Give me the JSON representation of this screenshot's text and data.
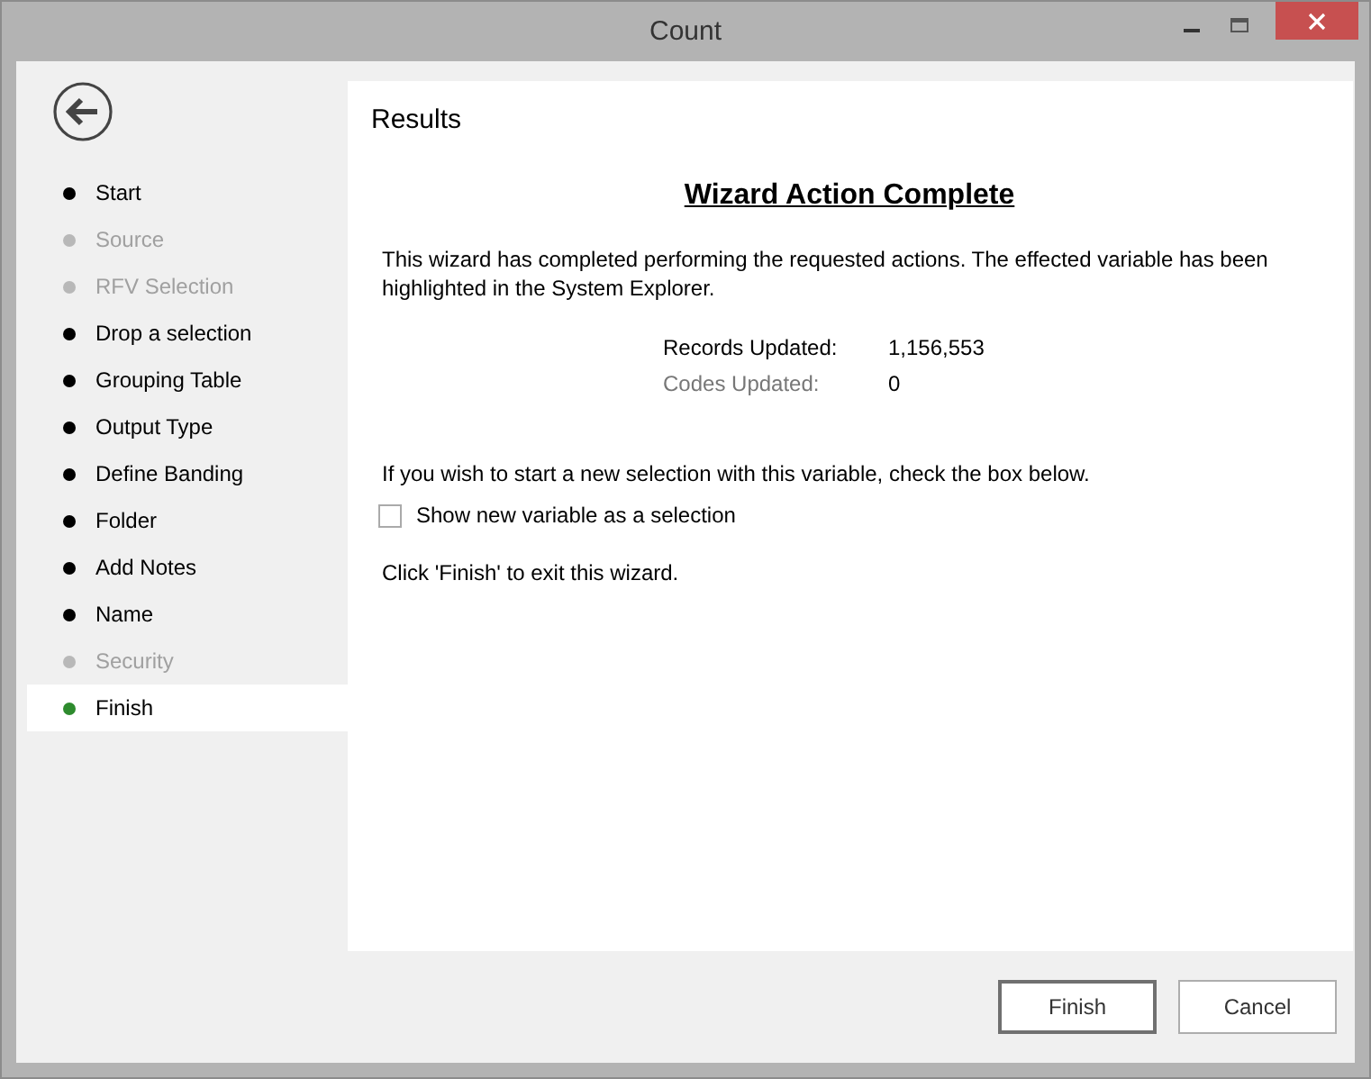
{
  "window": {
    "title": "Count"
  },
  "steps": [
    {
      "label": "Start",
      "disabled": false,
      "selected": false
    },
    {
      "label": "Source",
      "disabled": true,
      "selected": false
    },
    {
      "label": "RFV Selection",
      "disabled": true,
      "selected": false
    },
    {
      "label": "Drop a selection",
      "disabled": false,
      "selected": false
    },
    {
      "label": "Grouping Table",
      "disabled": false,
      "selected": false
    },
    {
      "label": "Output Type",
      "disabled": false,
      "selected": false
    },
    {
      "label": "Define Banding",
      "disabled": false,
      "selected": false
    },
    {
      "label": "Folder",
      "disabled": false,
      "selected": false
    },
    {
      "label": "Add Notes",
      "disabled": false,
      "selected": false
    },
    {
      "label": "Name",
      "disabled": false,
      "selected": false
    },
    {
      "label": "Security",
      "disabled": true,
      "selected": false
    },
    {
      "label": "Finish",
      "disabled": false,
      "selected": true
    }
  ],
  "page": {
    "title": "Results",
    "heading": "Wizard Action Complete",
    "message": "This wizard has completed performing the requested actions. The effected variable has been highlighted in the System Explorer.",
    "stats": [
      {
        "label": "Records Updated:",
        "value": "1,156,553",
        "disabled": false
      },
      {
        "label": "Codes Updated:",
        "value": "0",
        "disabled": true
      }
    ],
    "hint": "If you wish to start a new selection with this variable, check the box below.",
    "checkbox": {
      "label": "Show new variable as a selection",
      "checked": false
    },
    "footer_note": "Click 'Finish' to exit this wizard."
  },
  "buttons": [
    {
      "label": "Finish",
      "selected": true
    },
    {
      "label": "Cancel",
      "selected": false
    }
  ]
}
